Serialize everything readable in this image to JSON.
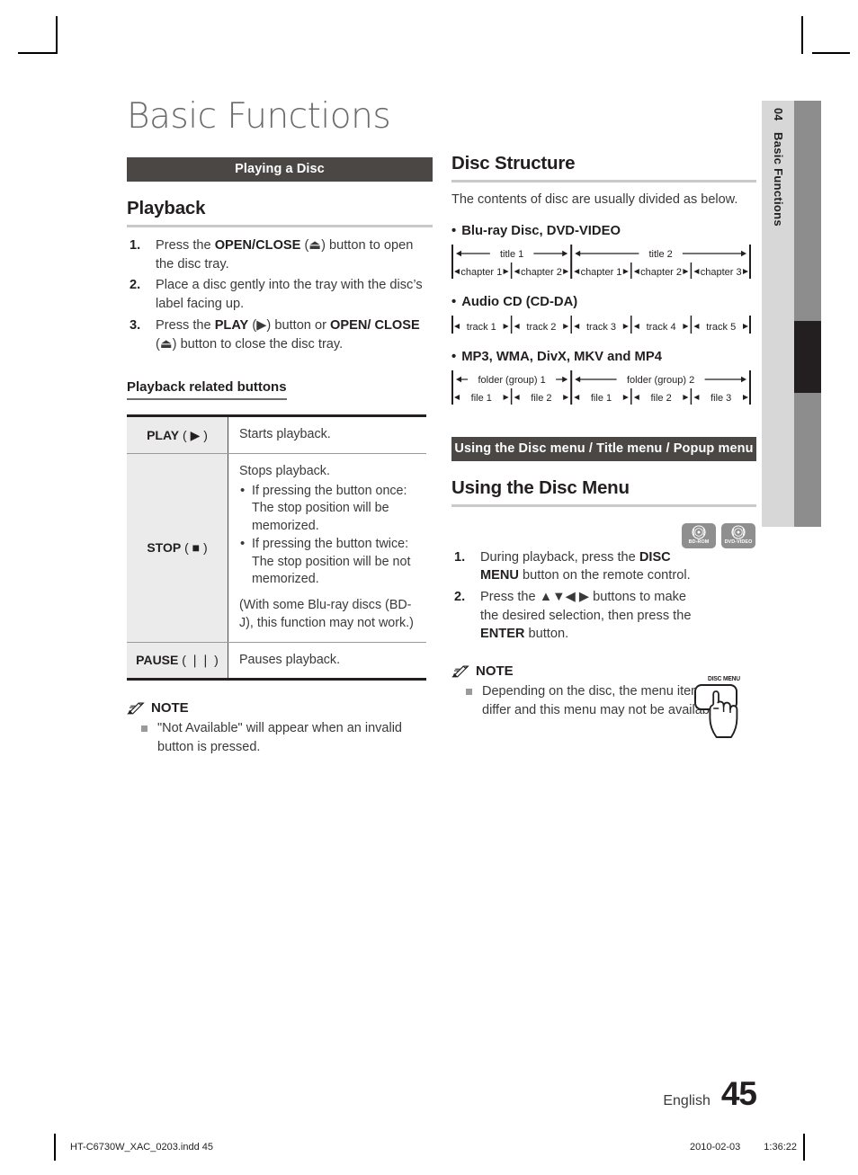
{
  "page": {
    "title": "Basic Functions",
    "language": "English",
    "number": "45"
  },
  "side_tab": {
    "chapter_number": "04",
    "chapter_name": "Basic Functions"
  },
  "colors": {
    "band": "#4a4745",
    "side_tab": "#d7d7d7",
    "side_bar": "#8d8d8d",
    "side_marker": "#231f20",
    "rule": "#c9c9c9",
    "table_key_bg": "#ebebeb",
    "badge": "#8f8f8f"
  },
  "left_column": {
    "band_label": "Playing a Disc",
    "section_title": "Playback",
    "steps": [
      {
        "num": "1.",
        "parts": [
          {
            "t": "Press the ",
            "b": false
          },
          {
            "t": "OPEN/CLOSE",
            "b": true
          },
          {
            "t": " (⏏) button to open the disc tray.",
            "b": false
          }
        ]
      },
      {
        "num": "2.",
        "parts": [
          {
            "t": "Place a disc gently into the tray with the disc’s label facing up.",
            "b": false
          }
        ]
      },
      {
        "num": "3.",
        "parts": [
          {
            "t": "Press the ",
            "b": false
          },
          {
            "t": "PLAY",
            "b": true
          },
          {
            "t": " (▶) button or ",
            "b": false
          },
          {
            "t": "OPEN/ CLOSE",
            "b": true
          },
          {
            "t": " (⏏) button to close the disc tray.",
            "b": false
          }
        ]
      }
    ],
    "table_heading": "Playback related buttons",
    "table": [
      {
        "key_label": "PLAY",
        "key_symbol": "▶",
        "desc_lead": "Starts playback.",
        "bullets": [],
        "paren": ""
      },
      {
        "key_label": "STOP",
        "key_symbol": "■",
        "desc_lead": "Stops playback.",
        "bullets": [
          "If pressing the button once: The stop position will be memorized.",
          "If pressing the button twice: The stop position will be not memorized."
        ],
        "paren": "(With some Blu-ray discs (BD-J), this function may not work.)"
      },
      {
        "key_label": "PAUSE",
        "key_symbol": "❘❘",
        "desc_lead": "Pauses playback.",
        "bullets": [],
        "paren": ""
      }
    ],
    "note": {
      "title": "NOTE",
      "items": [
        "\"Not Available\" will appear when an invalid button is pressed."
      ]
    }
  },
  "right_column": {
    "section_title": "Disc Structure",
    "intro": "The contents of disc are usually divided as below.",
    "diagrams": [
      {
        "bullet_label": "Blu-ray Disc, DVD-VIDEO",
        "top_row": [
          "title 1",
          "title 2"
        ],
        "bottom_row": [
          "chapter 1",
          "chapter 2",
          "chapter 1",
          "chapter 2",
          "chapter 3"
        ]
      },
      {
        "bullet_label": "Audio CD (CD-DA)",
        "top_row": [],
        "bottom_row": [
          "track 1",
          "track 2",
          "track 3",
          "track 4",
          "track 5"
        ]
      },
      {
        "bullet_label": "MP3, WMA, DivX, MKV and MP4",
        "top_row": [
          "folder (group) 1",
          "folder (group) 2"
        ],
        "bottom_row": [
          "file 1",
          "file 2",
          "file 1",
          "file 2",
          "file 3"
        ]
      }
    ],
    "band_label": "Using the Disc menu / Title menu / Popup menu",
    "menu_section_title": "Using the Disc Menu",
    "badges": [
      "BD-ROM",
      "DVD-VIDEO"
    ],
    "remote_label": "DISC MENU",
    "steps": [
      {
        "num": "1.",
        "parts": [
          {
            "t": "During playback, press the ",
            "b": false
          },
          {
            "t": "DISC MENU",
            "b": true
          },
          {
            "t": "  button on the remote control.",
            "b": false
          }
        ]
      },
      {
        "num": "2.",
        "parts": [
          {
            "t": "Press the ▲▼◀ ▶ buttons to make the desired selection, then press the ",
            "b": false
          },
          {
            "t": "ENTER",
            "b": true
          },
          {
            "t": " button.",
            "b": false
          }
        ]
      }
    ],
    "note": {
      "title": "NOTE",
      "items": [
        "Depending on the disc, the menu items may differ and this menu may not be available."
      ]
    }
  },
  "footer": {
    "file_name": "HT-C6730W_XAC_0203.indd   45",
    "date": "2010-02-03",
    "time": "1:36:22"
  }
}
